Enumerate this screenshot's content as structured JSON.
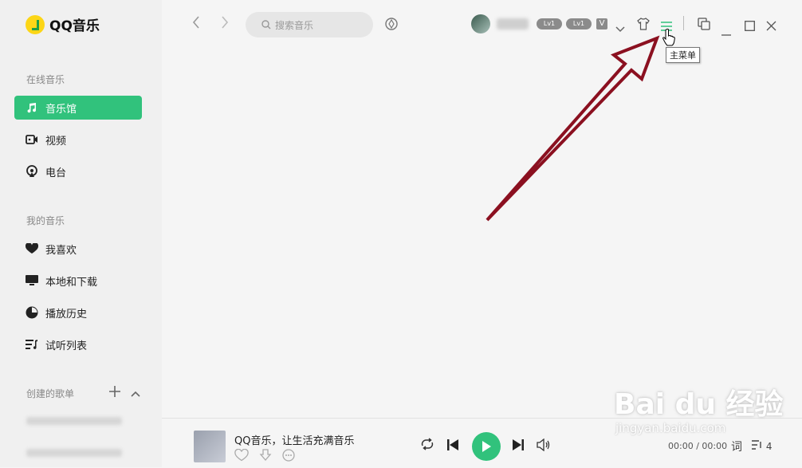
{
  "app": {
    "name": "QQ音乐"
  },
  "sidebar": {
    "online_title": "在线音乐",
    "online_items": [
      {
        "label": "音乐馆",
        "icon": "music-note-icon",
        "active": true
      },
      {
        "label": "视频",
        "icon": "video-icon"
      },
      {
        "label": "电台",
        "icon": "radio-icon"
      }
    ],
    "my_title": "我的音乐",
    "my_items": [
      {
        "label": "我喜欢",
        "icon": "heart-icon"
      },
      {
        "label": "本地和下载",
        "icon": "monitor-icon"
      },
      {
        "label": "播放历史",
        "icon": "history-icon"
      },
      {
        "label": "试听列表",
        "icon": "playlist-icon"
      }
    ],
    "created_title": "创建的歌单"
  },
  "topbar": {
    "search_placeholder": "搜索音乐",
    "badge1": "Lv1",
    "badge2": "Lv1",
    "vip_badge": "V",
    "tooltip": "主菜单"
  },
  "player": {
    "song_title": "QQ音乐，让生活充满音乐",
    "time": "00:00 / 00:00",
    "lyric_label": "词",
    "queue_count": "4"
  },
  "watermark": {
    "main": "Bai du 经验",
    "sub": "jingyan.baidu.com"
  },
  "colors": {
    "accent": "#31c27c",
    "annotation_arrow": "#8b1020"
  }
}
